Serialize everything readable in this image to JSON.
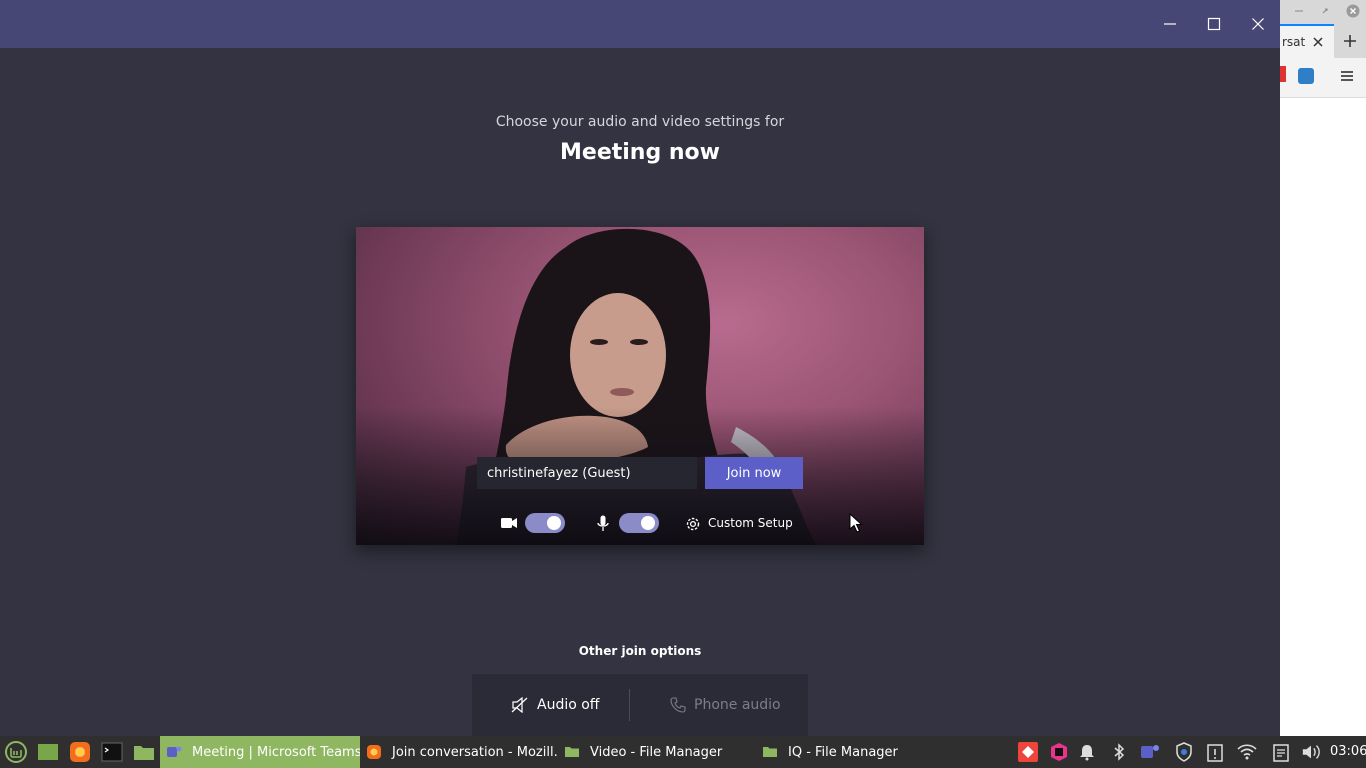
{
  "teams": {
    "subtitle": "Choose your audio and video settings for",
    "title": "Meeting now",
    "name_value": "christinefayez (Guest)",
    "join_label": "Join now",
    "custom_setup_label": "Custom Setup",
    "camera_on": true,
    "mic_on": true,
    "other_options_label": "Other join options",
    "audio_off_label": "Audio off",
    "phone_audio_label": "Phone audio",
    "colors": {
      "titlebar": "#464775",
      "background": "#333341",
      "accent": "#5b5fc7"
    }
  },
  "firefox": {
    "tab_text": "rsat"
  },
  "taskbar": {
    "tasks": [
      {
        "label": "Meeting | Microsoft Teams",
        "icon": "teams-icon",
        "active": true
      },
      {
        "label": "Join conversation - Mozill...",
        "icon": "firefox-icon",
        "active": false
      },
      {
        "label": "Video - File Manager",
        "icon": "folder-icon",
        "active": false
      },
      {
        "label": "IQ - File Manager",
        "icon": "folder-icon",
        "active": false
      }
    ],
    "clock": "03:06"
  }
}
